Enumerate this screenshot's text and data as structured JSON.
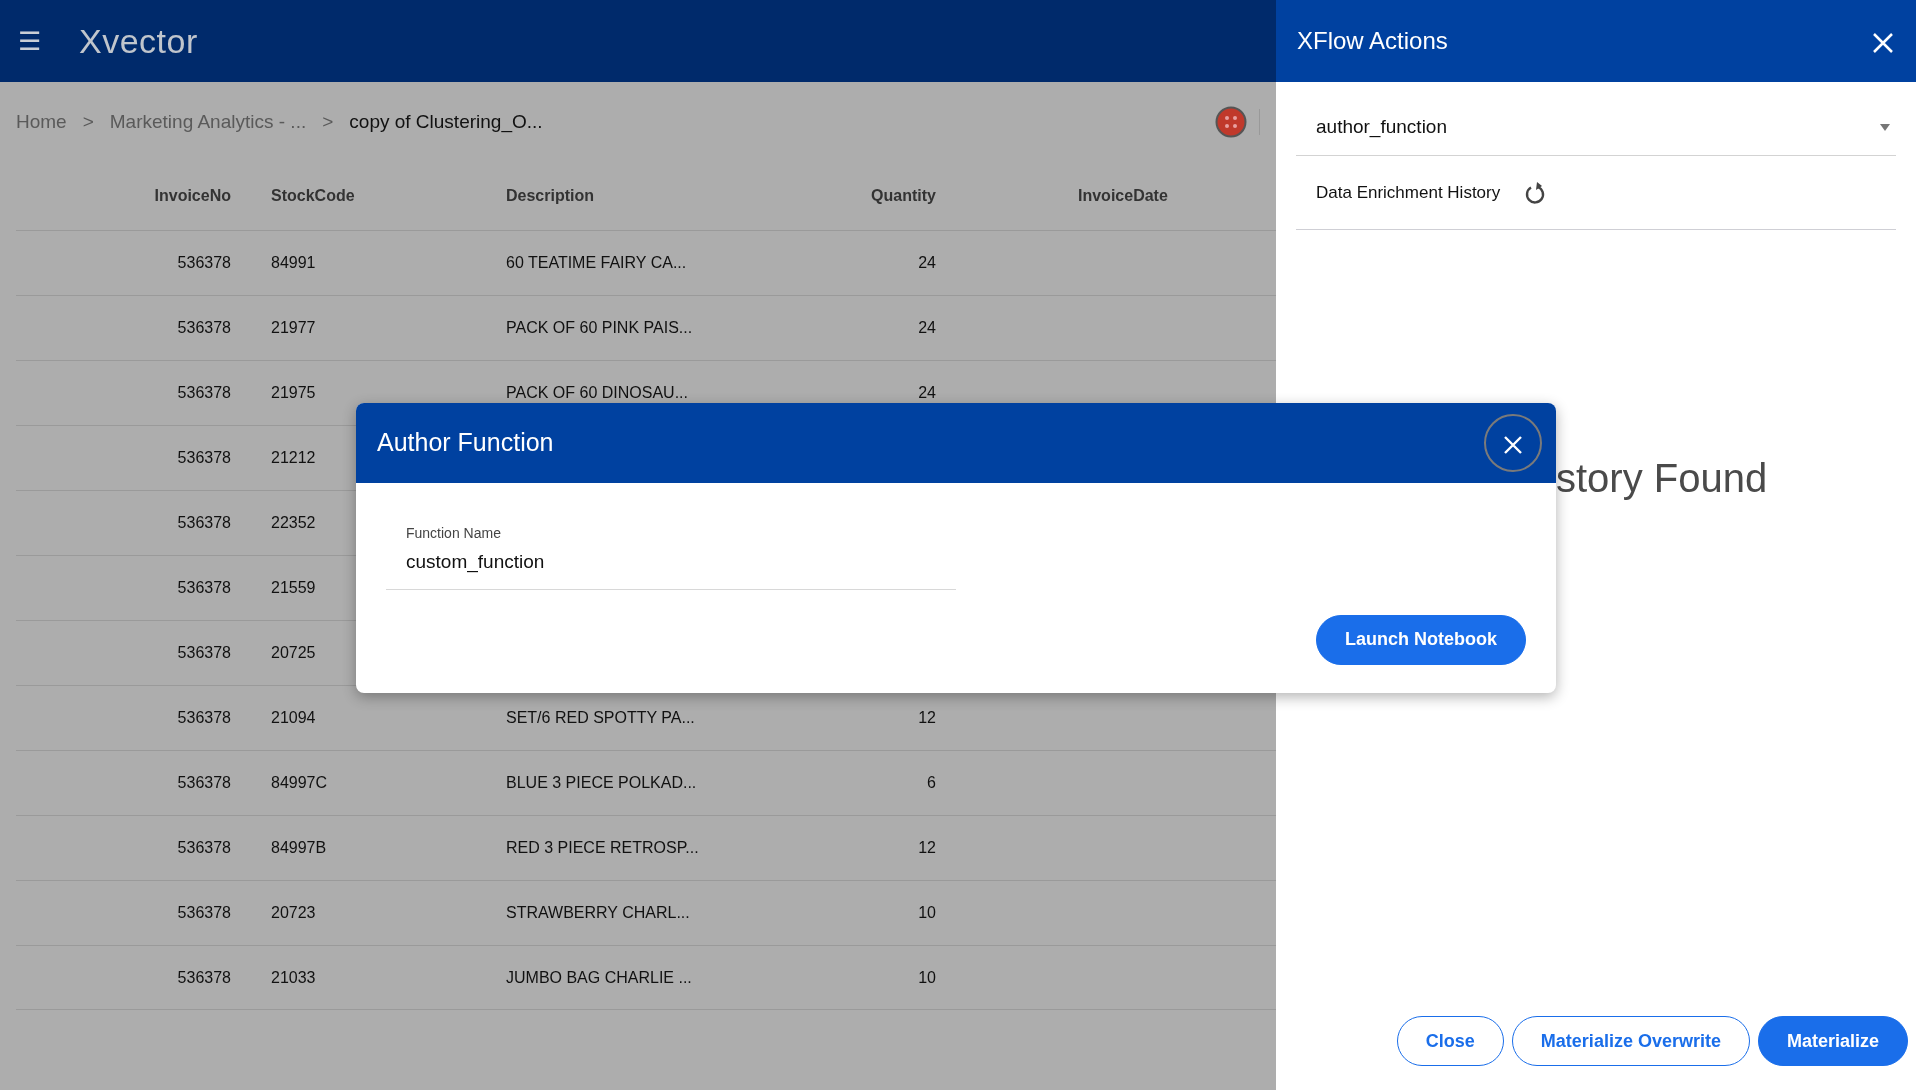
{
  "app": {
    "menu_icon": "☰",
    "logo": "Xvector"
  },
  "breadcrumb": [
    {
      "label": "Home",
      "current": false
    },
    {
      "label": "Marketing Analytics - ...",
      "current": false
    },
    {
      "label": "copy of Clustering_O...",
      "current": true
    }
  ],
  "breadcrumb_separator": ">",
  "table": {
    "columns": [
      "InvoiceNo",
      "StockCode",
      "Description",
      "Quantity",
      "InvoiceDate"
    ],
    "rows": [
      {
        "invoice": "536378",
        "stock": "84991",
        "description": "60 TEATIME FAIRY CA...",
        "quantity": "24"
      },
      {
        "invoice": "536378",
        "stock": "21977",
        "description": "PACK OF 60 PINK PAIS...",
        "quantity": "24"
      },
      {
        "invoice": "536378",
        "stock": "21975",
        "description": "PACK OF 60 DINOSAU...",
        "quantity": "24"
      },
      {
        "invoice": "536378",
        "stock": "21212"
      },
      {
        "invoice": "536378",
        "stock": "22352"
      },
      {
        "invoice": "536378",
        "stock": "21559"
      },
      {
        "invoice": "536378",
        "stock": "20725"
      },
      {
        "invoice": "536378",
        "stock": "21094",
        "description": "SET/6 RED SPOTTY PA...",
        "quantity": "12"
      },
      {
        "invoice": "536378",
        "stock": "84997C",
        "description": "BLUE 3 PIECE POLKAD...",
        "quantity": "6"
      },
      {
        "invoice": "536378",
        "stock": "84997B",
        "description": "RED 3 PIECE RETROSP...",
        "quantity": "12"
      },
      {
        "invoice": "536378",
        "stock": "20723",
        "description": "STRAWBERRY CHARL...",
        "quantity": "10"
      },
      {
        "invoice": "536378",
        "stock": "21033",
        "description": "JUMBO BAG CHARLIE ...",
        "quantity": "10"
      }
    ]
  },
  "side_panel": {
    "title": "XFlow Actions",
    "action_select": {
      "value": "author_function"
    },
    "history_title": "Data Enrichment History",
    "empty_message": "story Found",
    "buttons": [
      {
        "label": "Close",
        "kind": "outline"
      },
      {
        "label": "Materialize Overwrite",
        "kind": "outline"
      },
      {
        "label": "Materialize",
        "kind": "primary"
      }
    ]
  },
  "dialog": {
    "title": "Author Function",
    "field": {
      "label": "Function Name",
      "value": "custom_function"
    },
    "button": "Launch Notebook"
  }
}
